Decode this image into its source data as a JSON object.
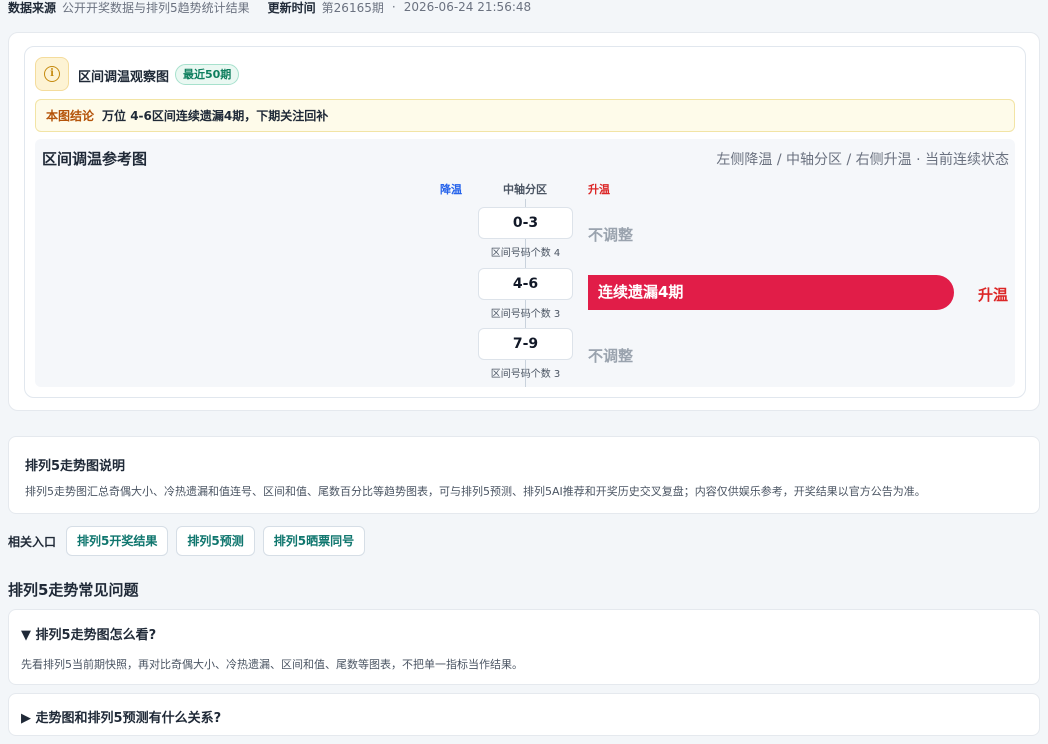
{
  "meta": {
    "source_label": "数据来源",
    "source_value": "公开开奖数据与排列5趋势统计结果",
    "updated_label": "更新时间",
    "issue": "第26165期",
    "separator": "·",
    "timestamp": "2026-06-24 21:56:48"
  },
  "observe": {
    "title": "区间调温观察图",
    "badge": "最近50期",
    "conclusion_label": "本图结论",
    "conclusion_text": "万位 4-6区间连续遗漏4期，下期关注回补"
  },
  "chart": {
    "title": "区间调温参考图",
    "note": "左侧降温 / 中轴分区 / 右侧升温 · 当前连续状态",
    "col_cool": "降温",
    "col_axis": "中轴分区",
    "col_warm": "升温"
  },
  "chart_data": {
    "type": "bar",
    "categories": [
      "0-3",
      "4-6",
      "7-9"
    ],
    "counts": [
      "区间号码个数 4",
      "区间号码个数 3",
      "区间号码个数 3"
    ],
    "rows": [
      {
        "zone": "0-3",
        "count_label": "区间号码个数 4",
        "direction": "none",
        "status": "不调整"
      },
      {
        "zone": "4-6",
        "count_label": "区间号码个数 3",
        "direction": "warm",
        "bar_text": "连续遗漏4期",
        "tag": "升温",
        "miss_streak": 4
      },
      {
        "zone": "7-9",
        "count_label": "区间号码个数 3",
        "direction": "none",
        "status": "不调整"
      }
    ],
    "colors": {
      "warm": "#e11d48",
      "cool": "#2563eb"
    }
  },
  "description": {
    "title": "排列5走势图说明",
    "text": "排列5走势图汇总奇偶大小、冷热遗漏和值连号、区间和值、尾数百分比等趋势图表，可与排列5预测、排列5AI推荐和开奖历史交叉复盘；内容仅供娱乐参考，开奖结果以官方公告为准。"
  },
  "related": {
    "label": "相关入口",
    "links": [
      "排列5开奖结果",
      "排列5预测",
      "排列5晒票同号"
    ]
  },
  "faq": {
    "title": "排列5走势常见问题",
    "items": [
      {
        "q": "▼ 排列5走势图怎么看?",
        "a": "先看排列5当前期快照，再对比奇偶大小、冷热遗漏、区间和值、尾数等图表，不把单一指标当作结果。"
      },
      {
        "q": "▶ 走势图和排列5预测有什么关系?"
      }
    ]
  }
}
